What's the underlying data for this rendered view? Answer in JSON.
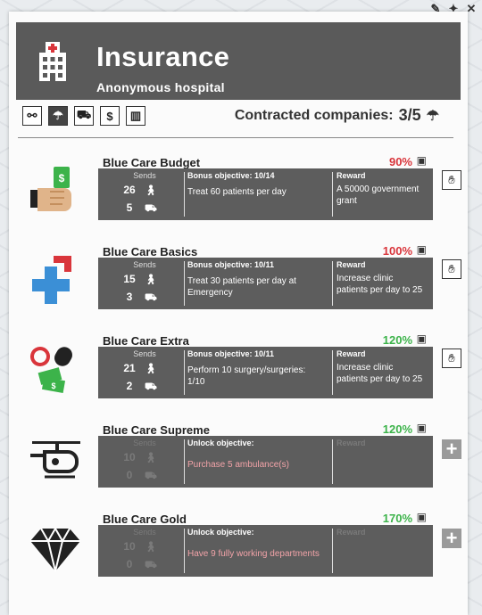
{
  "window_controls": {
    "pin": "✎",
    "pin2": "✦",
    "close": "✕"
  },
  "header": {
    "title": "Insurance",
    "subtitle": "Anonymous hospital",
    "icon": "hospital-icon"
  },
  "filters": [
    {
      "name": "filter-network",
      "glyph": "⚯",
      "active": false
    },
    {
      "name": "filter-umbrella",
      "glyph": "☂",
      "active": true
    },
    {
      "name": "filter-ambulance",
      "glyph": "⛟",
      "active": false
    },
    {
      "name": "filter-money",
      "glyph": "$",
      "active": false
    },
    {
      "name": "filter-chart",
      "glyph": "▥",
      "active": false
    }
  ],
  "contracted": {
    "label": "Contracted companies:",
    "count": "3/5",
    "icon": "umbrella-icon"
  },
  "columns": {
    "sends": "Sends",
    "bonus": "Bonus objective:",
    "unlock": "Unlock objective:",
    "reward": "Reward"
  },
  "companies": [
    {
      "name": "Blue Care Budget",
      "pct": "90%",
      "pct_color": "red",
      "objective_label": "Bonus objective: 10/14",
      "objective": "Treat 60 patients per day",
      "reward": "A 50000 government grant",
      "sends_patients": "26",
      "sends_ambulance": "5",
      "locked": false,
      "icon": "money-hand-icon"
    },
    {
      "name": "Blue Care Basics",
      "pct": "100%",
      "pct_color": "red",
      "objective_label": "Bonus objective: 10/11",
      "objective": "Treat 30 patients per day at Emergency",
      "reward": "Increase clinic patients per day to 25",
      "sends_patients": "15",
      "sends_ambulance": "3",
      "locked": false,
      "icon": "medical-cross-icon"
    },
    {
      "name": "Blue Care Extra",
      "pct": "120%",
      "pct_color": "green",
      "objective_label": "Bonus objective: 10/11",
      "objective": "Perform 10 surgery/surgeries: 1/10",
      "reward": "Increase clinic patients per day to 25",
      "sends_patients": "21",
      "sends_ambulance": "2",
      "locked": false,
      "icon": "pills-money-icon"
    },
    {
      "name": "Blue Care Supreme",
      "pct": "120%",
      "pct_color": "green",
      "objective_label": "Unlock objective:",
      "objective": "Purchase 5 ambulance(s)",
      "reward": "",
      "sends_patients": "10",
      "sends_ambulance": "0",
      "locked": true,
      "icon": "helicopter-icon"
    },
    {
      "name": "Blue Care Gold",
      "pct": "170%",
      "pct_color": "green",
      "objective_label": "Unlock objective:",
      "objective": "Have 9 fully working departments",
      "reward": "",
      "sends_patients": "10",
      "sends_ambulance": "0",
      "locked": true,
      "icon": "diamond-icon"
    }
  ],
  "colors": {
    "header_bg": "#5a5a5a",
    "box_bg": "#5d5d5d",
    "red": "#d9353b",
    "green": "#3cb34a",
    "locked_text": "#f2a3a8"
  }
}
